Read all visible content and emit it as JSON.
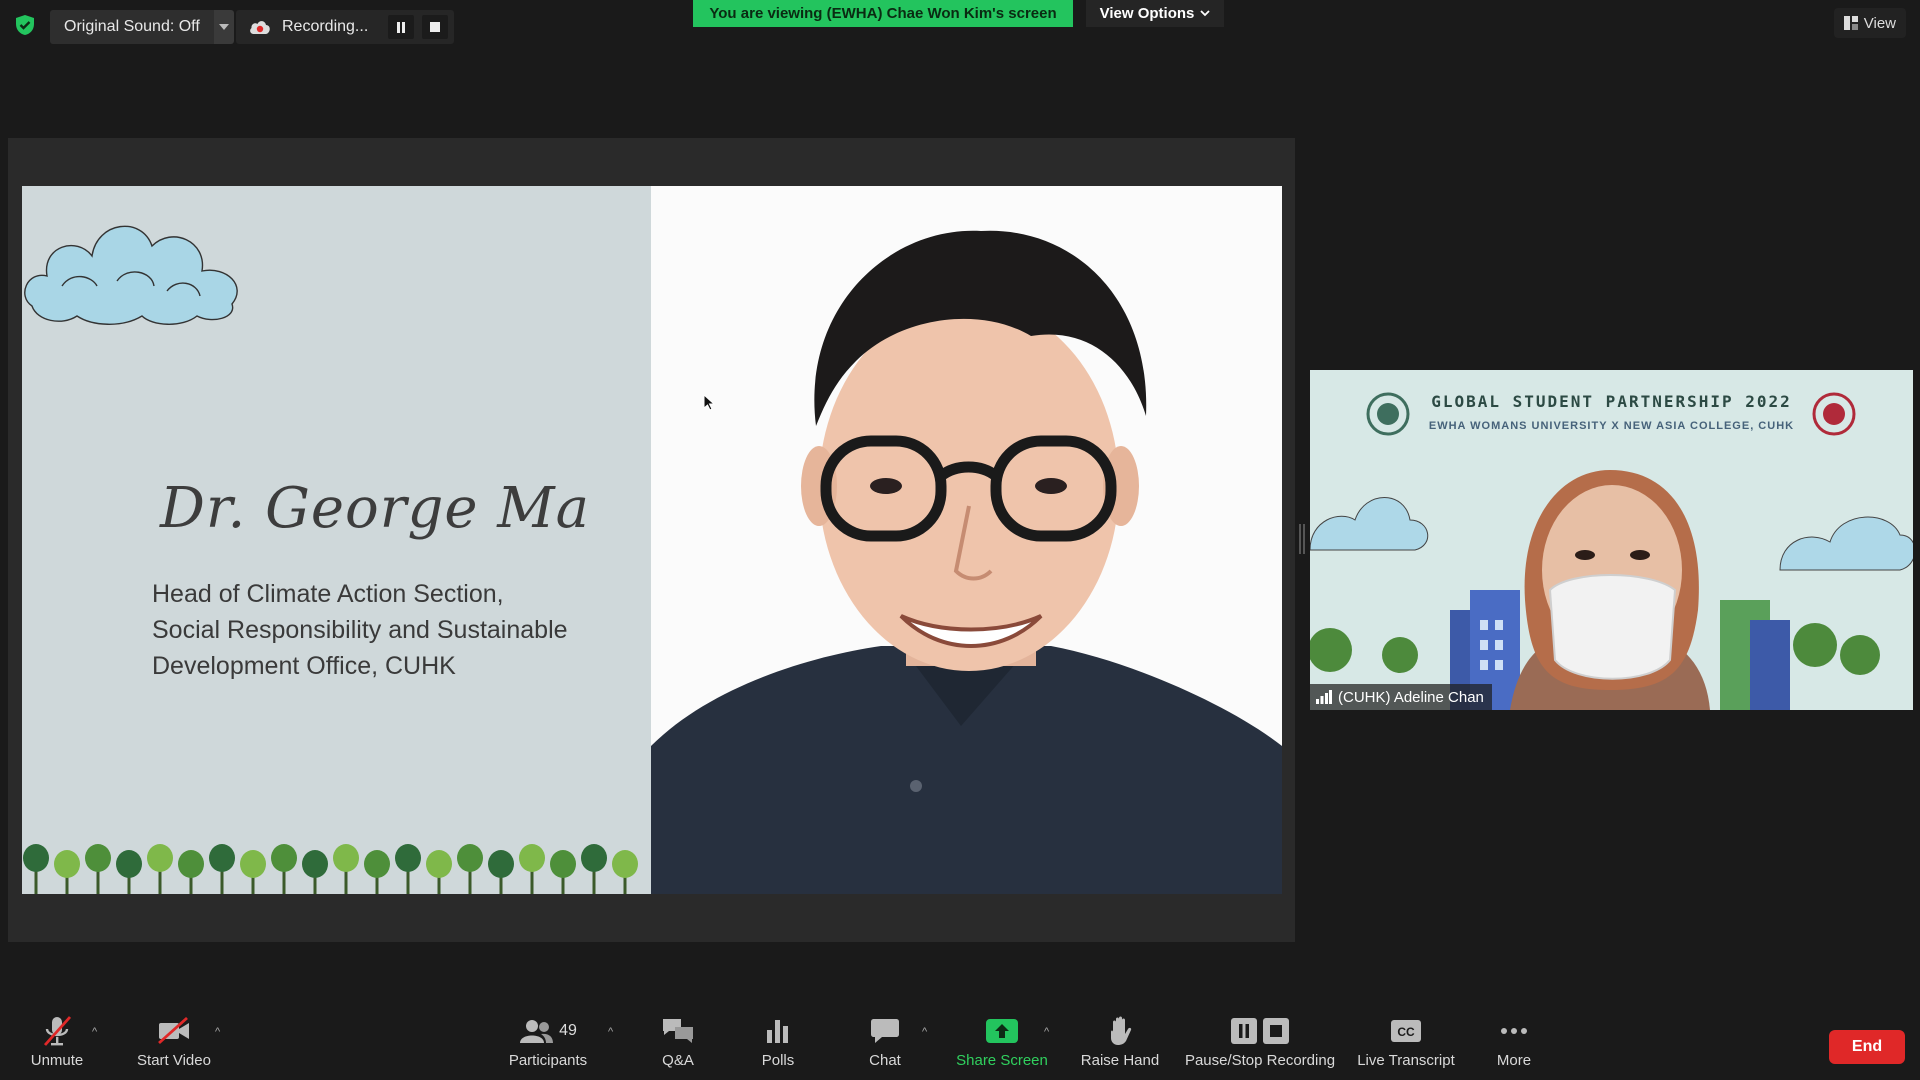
{
  "topbar": {
    "original_sound_label": "Original Sound: Off",
    "recording_label": "Recording...",
    "viewing_banner": "You are viewing (EWHA) Chae Won Kim's screen",
    "view_options_label": "View Options",
    "view_label": "View"
  },
  "slide": {
    "speaker_name": "Dr. George Ma",
    "title_lines": [
      "Head of Climate Action Section,",
      "Social Responsibility and Sustainable",
      "Development Office, CUHK"
    ]
  },
  "participant_tile": {
    "header": "GLOBAL STUDENT PARTNERSHIP 2022",
    "subheader": "EWHA WOMANS UNIVERSITY X NEW ASIA COLLEGE, CUHK",
    "name": "(CUHK) Adeline Chan"
  },
  "toolbar": {
    "unmute": "Unmute",
    "start_video": "Start Video",
    "participants": "Participants",
    "participants_count": "49",
    "qa": "Q&A",
    "polls": "Polls",
    "chat": "Chat",
    "share_screen": "Share Screen",
    "raise_hand": "Raise Hand",
    "pause_stop_recording": "Pause/Stop Recording",
    "live_transcript": "Live Transcript",
    "more": "More",
    "end": "End"
  },
  "colors": {
    "accent_green": "#23c45e",
    "end_red": "#e02828",
    "background": "#1a1a1a"
  }
}
